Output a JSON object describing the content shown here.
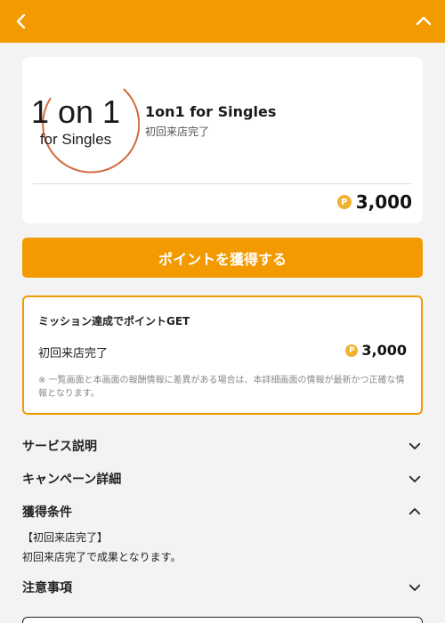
{
  "header": {
    "back_icon": "chevron-left-icon",
    "collapse_icon": "chevron-up-icon",
    "color": "#f29a00"
  },
  "shop": {
    "logo_line1": "1 on 1",
    "logo_line2": "for Singles",
    "name": "1on1 for Singles",
    "subtitle": "初回来店完了",
    "points": "3,000",
    "coin_symbol": "P"
  },
  "cta": {
    "label": "ポイントを獲得する"
  },
  "mission": {
    "title": "ミッション達成でポイントGET",
    "item_label": "初回来店完了",
    "points": "3,000",
    "coin_symbol": "P",
    "note": "※ 一覧画面と本画面の報酬情報に差異がある場合は、本詳細画面の情報が最新かつ正確な情報となります。"
  },
  "sections": {
    "service": "サービス説明",
    "campaign": "キャンペーン詳細",
    "conditions": "獲得条件",
    "conditions_line1": "【初回来店完了】",
    "conditions_line2": "初回来店完了で成果となります。",
    "notes": "注意事項"
  }
}
